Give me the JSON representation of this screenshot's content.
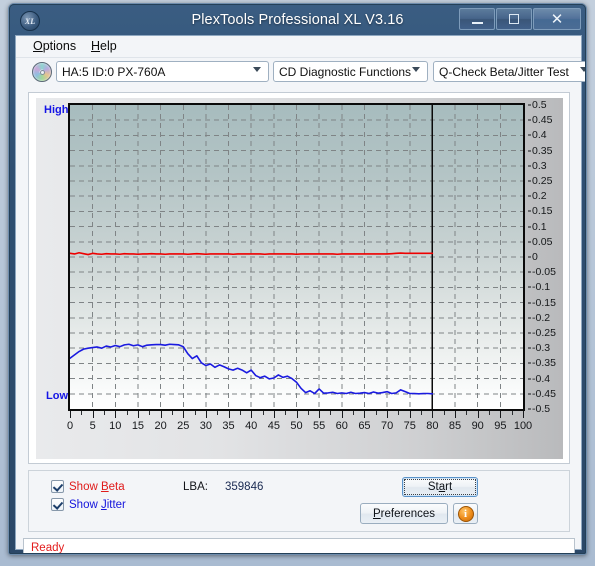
{
  "window": {
    "title": "PlexTools Professional XL V3.16",
    "icon": "disc-xl-icon",
    "minimize_label": "–",
    "maximize_label": "□",
    "close_label": "✕",
    "app_badge": "XL"
  },
  "menu": {
    "items": [
      {
        "pre": "",
        "accel": "O",
        "post": "ptions"
      },
      {
        "pre": "",
        "accel": "H",
        "post": "elp"
      }
    ],
    "labels": [
      "Options",
      "Help"
    ]
  },
  "toolbar": {
    "drive_combo": "HA:5 ID:0  PX-760A",
    "function_combo": "CD Diagnostic Functions",
    "test_combo": "Q-Check Beta/Jitter Test",
    "disc_icon": "cd-disc-icon"
  },
  "chart_labels": {
    "high": "High",
    "low": "Low"
  },
  "controls": {
    "show_beta_pre": "Show ",
    "show_beta_accel": "B",
    "show_beta_post": "eta",
    "show_beta_label": "Show Beta",
    "show_beta_checked": true,
    "show_jitter_pre": "Show ",
    "show_jitter_accel": "J",
    "show_jitter_post": "itter",
    "show_jitter_label": "Show Jitter",
    "show_jitter_checked": true,
    "lba_label": "LBA:",
    "lba_value": "359846",
    "start_pre": "St",
    "start_accel": "a",
    "start_post": "rt",
    "start_label": "Start",
    "prefs_accel": "P",
    "prefs_post": "references",
    "prefs_label": "Preferences",
    "info_label": "i"
  },
  "status": {
    "text": "Ready"
  },
  "colors": {
    "beta_line": "#ee0000",
    "jitter_line": "#1a1ae0",
    "axis": "#0a0a0a",
    "grid": "#7f8486",
    "high_low_label": "#1414e6",
    "status_text": "#e21b1b",
    "titlebar": "#2f4f72"
  },
  "chart_data": {
    "type": "line",
    "title": "Q-Check Beta/Jitter Test",
    "xlabel": "",
    "ylabel": "",
    "xlim": [
      0,
      100
    ],
    "ylim": [
      -0.5,
      0.5
    ],
    "xticks": [
      0,
      5,
      10,
      15,
      20,
      25,
      30,
      35,
      40,
      45,
      50,
      55,
      60,
      65,
      70,
      75,
      80,
      85,
      90,
      95,
      100
    ],
    "yticks": [
      0.5,
      0.45,
      0.4,
      0.35,
      0.3,
      0.25,
      0.2,
      0.15,
      0.1,
      0.05,
      0,
      -0.05,
      -0.1,
      -0.15,
      -0.2,
      -0.25,
      -0.3,
      -0.35,
      -0.4,
      -0.45,
      -0.5
    ],
    "grid": true,
    "grid_style": "dashed",
    "legend": [
      "Show Beta",
      "Show Jitter"
    ],
    "legend_position": "below-left",
    "data_end_marker_x": 80,
    "annotations": [
      {
        "text": "High",
        "position": "top-left-outside"
      },
      {
        "text": "Low",
        "position": "bottom-left-outside"
      }
    ],
    "series": [
      {
        "name": "Beta",
        "color": "#ee0000",
        "x": [
          0,
          1,
          2,
          3,
          4,
          5,
          6,
          7,
          8,
          9,
          10,
          11,
          12,
          13,
          14,
          15,
          16,
          17,
          18,
          19,
          20,
          21,
          22,
          23,
          24,
          25,
          26,
          27,
          28,
          29,
          30,
          31,
          32,
          33,
          34,
          35,
          36,
          37,
          38,
          39,
          40,
          41,
          42,
          43,
          44,
          45,
          46,
          47,
          48,
          49,
          50,
          51,
          52,
          53,
          54,
          55,
          56,
          57,
          58,
          59,
          60,
          61,
          62,
          63,
          64,
          65,
          66,
          67,
          68,
          69,
          70,
          71,
          72,
          73,
          74,
          75,
          76,
          77,
          78,
          79,
          80
        ],
        "values": [
          0.012,
          0.01,
          0.014,
          0.011,
          0.008,
          0.012,
          0.01,
          0.009,
          0.011,
          0.01,
          0.01,
          0.009,
          0.011,
          0.01,
          0.01,
          0.009,
          0.01,
          0.01,
          0.011,
          0.01,
          0.01,
          0.009,
          0.01,
          0.01,
          0.01,
          0.01,
          0.009,
          0.01,
          0.011,
          0.01,
          0.009,
          0.01,
          0.01,
          0.01,
          0.01,
          0.01,
          0.009,
          0.01,
          0.01,
          0.01,
          0.01,
          0.01,
          0.01,
          0.009,
          0.01,
          0.01,
          0.01,
          0.01,
          0.01,
          0.01,
          0.009,
          0.01,
          0.01,
          0.01,
          0.01,
          0.01,
          0.01,
          0.01,
          0.01,
          0.009,
          0.01,
          0.01,
          0.01,
          0.01,
          0.01,
          0.01,
          0.01,
          0.01,
          0.01,
          0.01,
          0.01,
          0.011,
          0.012,
          0.013,
          0.012,
          0.012,
          0.012,
          0.012,
          0.012,
          0.012,
          0.012
        ]
      },
      {
        "name": "Jitter",
        "color": "#1a1ae0",
        "x": [
          0,
          1,
          2,
          3,
          4,
          5,
          6,
          7,
          8,
          9,
          10,
          11,
          12,
          13,
          14,
          15,
          16,
          17,
          18,
          19,
          20,
          21,
          22,
          23,
          24,
          25,
          26,
          27,
          28,
          29,
          30,
          31,
          32,
          33,
          34,
          35,
          36,
          37,
          38,
          39,
          40,
          41,
          42,
          43,
          44,
          45,
          46,
          47,
          48,
          49,
          50,
          51,
          52,
          53,
          54,
          55,
          56,
          57,
          58,
          59,
          60,
          61,
          62,
          63,
          64,
          65,
          66,
          67,
          68,
          69,
          70,
          71,
          72,
          73,
          74,
          75,
          76,
          77,
          78,
          79,
          80
        ],
        "values": [
          -0.333,
          -0.322,
          -0.311,
          -0.303,
          -0.3,
          -0.298,
          -0.296,
          -0.3,
          -0.293,
          -0.296,
          -0.291,
          -0.295,
          -0.289,
          -0.287,
          -0.292,
          -0.289,
          -0.295,
          -0.29,
          -0.289,
          -0.288,
          -0.288,
          -0.29,
          -0.287,
          -0.288,
          -0.289,
          -0.295,
          -0.318,
          -0.334,
          -0.325,
          -0.348,
          -0.357,
          -0.352,
          -0.363,
          -0.355,
          -0.361,
          -0.368,
          -0.372,
          -0.366,
          -0.372,
          -0.381,
          -0.372,
          -0.39,
          -0.397,
          -0.392,
          -0.401,
          -0.398,
          -0.388,
          -0.396,
          -0.392,
          -0.4,
          -0.412,
          -0.432,
          -0.446,
          -0.44,
          -0.449,
          -0.434,
          -0.448,
          -0.447,
          -0.445,
          -0.449,
          -0.447,
          -0.449,
          -0.445,
          -0.449,
          -0.448,
          -0.446,
          -0.449,
          -0.444,
          -0.448,
          -0.446,
          -0.443,
          -0.449,
          -0.447,
          -0.437,
          -0.443,
          -0.449,
          -0.449,
          -0.45,
          -0.449,
          -0.449,
          -0.45
        ]
      }
    ]
  }
}
